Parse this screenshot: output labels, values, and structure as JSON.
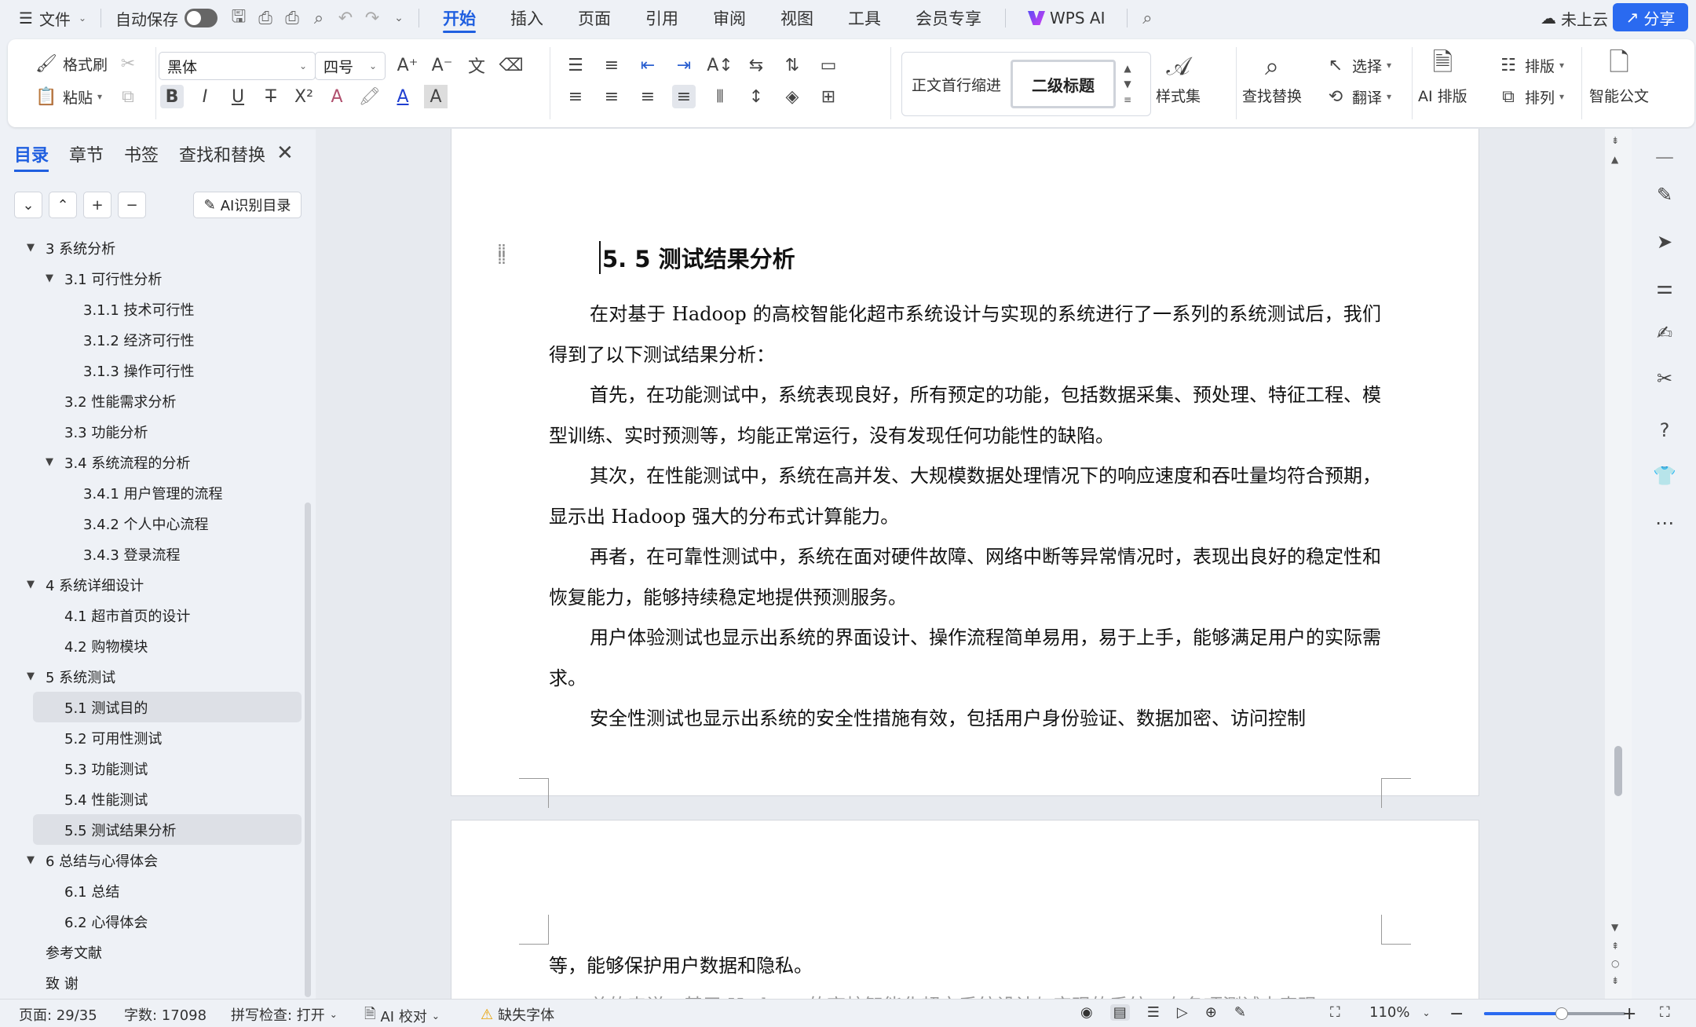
{
  "titlebar": {
    "file_menu": "文件",
    "autosave_label": "自动保存",
    "tabs": [
      "开始",
      "插入",
      "页面",
      "引用",
      "审阅",
      "视图",
      "工具",
      "会员专享"
    ],
    "active_tab": "开始",
    "wps_ai": "WPS AI",
    "cloud_status": "未上云",
    "share": "分享"
  },
  "ribbon": {
    "format_painter": "格式刷",
    "paste": "粘贴",
    "font_name": "黑体",
    "font_size": "四号",
    "style_normal": "正文首行缩进",
    "style_heading2": "二级标题",
    "style_set": "样式集",
    "find_replace": "查找替换",
    "select": "选择",
    "translate": "翻译",
    "ai_layout": "AI 排版",
    "layout": "排版",
    "arrange": "排列",
    "smart_doc": "智能公文"
  },
  "nav": {
    "tabs": [
      "目录",
      "章节",
      "书签",
      "查找和替换"
    ],
    "active_tab": "目录",
    "ai_toc": "AI识别目录",
    "toc": [
      {
        "label": "3 系统分析",
        "level": 1,
        "expanded": true
      },
      {
        "label": "3.1 可行性分析",
        "level": 2,
        "expanded": true
      },
      {
        "label": "3.1.1 技术可行性",
        "level": 3
      },
      {
        "label": "3.1.2 经济可行性",
        "level": 3
      },
      {
        "label": "3.1.3 操作可行性",
        "level": 3
      },
      {
        "label": "3.2 性能需求分析",
        "level": 2
      },
      {
        "label": "3.3 功能分析",
        "level": 2
      },
      {
        "label": "3.4 系统流程的分析",
        "level": 2,
        "expanded": true
      },
      {
        "label": "3.4.1  用户管理的流程",
        "level": 3
      },
      {
        "label": "3.4.2  个人中心流程",
        "level": 3
      },
      {
        "label": "3.4.3  登录流程",
        "level": 3
      },
      {
        "label": "4 系统详细设计",
        "level": 1,
        "expanded": true
      },
      {
        "label": "4.1 超市首页的设计",
        "level": 2
      },
      {
        "label": "4.2 购物模块",
        "level": 2
      },
      {
        "label": "5 系统测试",
        "level": 1,
        "expanded": true
      },
      {
        "label": "5.1 测试目的",
        "level": 2,
        "highlight": true
      },
      {
        "label": "5.2 可用性测试",
        "level": 2
      },
      {
        "label": "5.3 功能测试",
        "level": 2
      },
      {
        "label": "5.4 性能测试",
        "level": 2
      },
      {
        "label": "5.5 测试结果分析",
        "level": 2,
        "highlight": true
      },
      {
        "label": "6 总结与心得体会",
        "level": 1,
        "expanded": true
      },
      {
        "label": "6.1  总结",
        "level": 2
      },
      {
        "label": "6.2  心得体会",
        "level": 2
      },
      {
        "label": "参考文献",
        "level": 1
      },
      {
        "label": "致  谢",
        "level": 1
      }
    ]
  },
  "document": {
    "heading": "5. 5 测试结果分析",
    "paragraphs": [
      "在对基于 Hadoop 的高校智能化超市系统设计与实现的系统进行了一系列的系统测试后，我们得到了以下测试结果分析：",
      "首先，在功能测试中，系统表现良好，所有预定的功能，包括数据采集、预处理、特征工程、模型训练、实时预测等，均能正常运行，没有发现任何功能性的缺陷。",
      "其次，在性能测试中，系统在高并发、大规模数据处理情况下的响应速度和吞吐量均符合预期，显示出 Hadoop 强大的分布式计算能力。",
      "再者，在可靠性测试中，系统在面对硬件故障、网络中断等异常情况时，表现出良好的稳定性和恢复能力，能够持续稳定地提供预测服务。",
      "用户体验测试也显示出系统的界面设计、操作流程简单易用，易于上手，能够满足用户的实际需求。",
      "安全性测试也显示出系统的安全性措施有效，包括用户身份验证、数据加密、访问控制"
    ],
    "page_number": "29",
    "page2_text": "等，能够保护用户数据和隐私。",
    "page2_partial": "总的来说，基于 Hadoop 的高校智能化超市系统设计与实现的系统，在各项测试中表现"
  },
  "status": {
    "page": "页面: 29/35",
    "word_count": "字数: 17098",
    "spell_check": "拼写检查: 打开",
    "ai_proof": "AI 校对",
    "missing_font": "缺失字体",
    "zoom": "110%",
    "zoom_level": 0.55
  },
  "colors": {
    "accent": "#1f5fe0",
    "share_bg": "#2a6af0"
  }
}
